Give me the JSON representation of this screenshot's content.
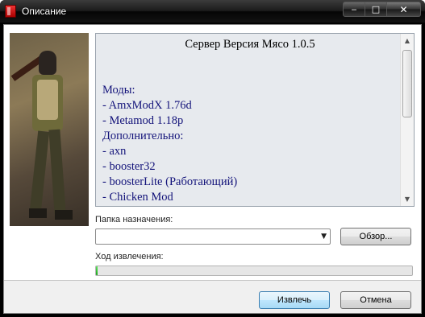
{
  "window": {
    "title": "Описание",
    "minimize_glyph": "‒",
    "maximize_glyph": "□",
    "close_glyph": "✕"
  },
  "side_image": {
    "icon": "soldier-artwork"
  },
  "description": {
    "heading": "Сервер Версия Мясо 1.0.5",
    "lines": [
      "Моды:",
      "- AmxModX 1.76d",
      "- Metamod 1.18p",
      "Дополнительно:",
      "- axn",
      "- booster32",
      "- boosterLite (Работающий)",
      "- Chicken Mod"
    ],
    "scroll_up_glyph": "▲",
    "scroll_down_glyph": "▼"
  },
  "destination": {
    "label": "Папка назначения:",
    "value": "",
    "dropdown_glyph": "▼",
    "browse_label": "Обзор..."
  },
  "progress": {
    "label": "Ход извлечения:",
    "percent": 0.5,
    "fill_color": "#2cc42c"
  },
  "footer": {
    "extract_label": "Извлечь",
    "cancel_label": "Отмена"
  }
}
